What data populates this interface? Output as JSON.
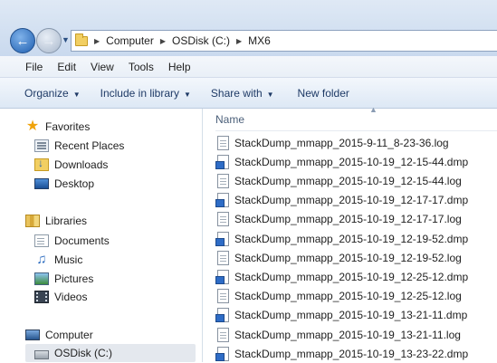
{
  "address": {
    "crumbs": [
      "Computer",
      "OSDisk (C:)",
      "MX6"
    ]
  },
  "menu": [
    "File",
    "Edit",
    "View",
    "Tools",
    "Help"
  ],
  "commands": [
    {
      "label": "Organize",
      "has_dropdown": true
    },
    {
      "label": "Include in library",
      "has_dropdown": true
    },
    {
      "label": "Share with",
      "has_dropdown": true
    },
    {
      "label": "New folder",
      "has_dropdown": false
    }
  ],
  "nav": {
    "favorites": "Favorites",
    "recent_places": "Recent Places",
    "downloads": "Downloads",
    "desktop": "Desktop",
    "libraries": "Libraries",
    "documents": "Documents",
    "music": "Music",
    "pictures": "Pictures",
    "videos": "Videos",
    "computer": "Computer",
    "osdisk": "OSDisk (C:)"
  },
  "content": {
    "column_name": "Name",
    "files": [
      {
        "name": "StackDump_mmapp_2015-9-11_8-23-36.log",
        "type": "log"
      },
      {
        "name": "StackDump_mmapp_2015-10-19_12-15-44.dmp",
        "type": "dmp"
      },
      {
        "name": "StackDump_mmapp_2015-10-19_12-15-44.log",
        "type": "log"
      },
      {
        "name": "StackDump_mmapp_2015-10-19_12-17-17.dmp",
        "type": "dmp"
      },
      {
        "name": "StackDump_mmapp_2015-10-19_12-17-17.log",
        "type": "log"
      },
      {
        "name": "StackDump_mmapp_2015-10-19_12-19-52.dmp",
        "type": "dmp"
      },
      {
        "name": "StackDump_mmapp_2015-10-19_12-19-52.log",
        "type": "log"
      },
      {
        "name": "StackDump_mmapp_2015-10-19_12-25-12.dmp",
        "type": "dmp"
      },
      {
        "name": "StackDump_mmapp_2015-10-19_12-25-12.log",
        "type": "log"
      },
      {
        "name": "StackDump_mmapp_2015-10-19_13-21-11.dmp",
        "type": "dmp"
      },
      {
        "name": "StackDump_mmapp_2015-10-19_13-21-11.log",
        "type": "log"
      },
      {
        "name": "StackDump_mmapp_2015-10-19_13-23-22.dmp",
        "type": "dmp"
      }
    ]
  }
}
